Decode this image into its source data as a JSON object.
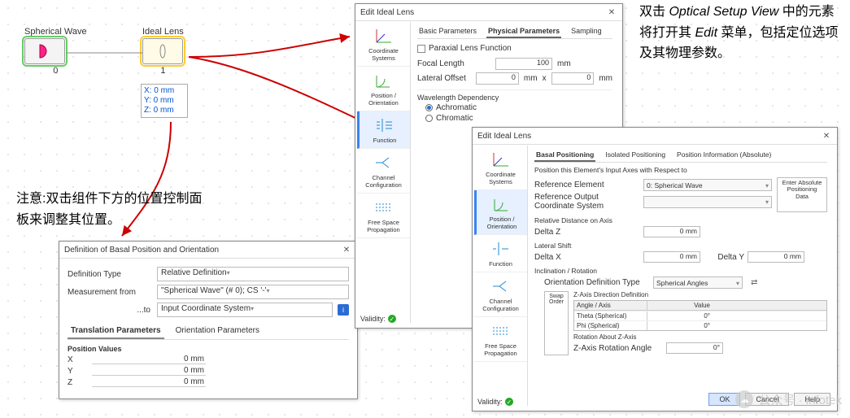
{
  "canvas": {
    "source": {
      "title": "Spherical Wave",
      "index": "0"
    },
    "lens": {
      "title": "Ideal Lens",
      "index": "1"
    },
    "pos_panel": {
      "x": "X: 0 mm",
      "y": "Y: 0 mm",
      "z": "Z: 0 mm"
    }
  },
  "anno_right_1": "双击 ",
  "anno_right_em1": "Optical Setup View",
  "anno_right_2": " 中的元素将打开其 ",
  "anno_right_em2": "Edit",
  "anno_right_3": " 菜单，包括定位选项及其物理参数。",
  "anno_left": "注意:双击组件下方的位置控制面板来调整其位置。",
  "d1": {
    "title": "Definition of Basal Position and Orientation",
    "deftype_label": "Definition Type",
    "deftype_value": "Relative Definition",
    "meas_label": "Measurement from",
    "meas_value": "\"Spherical Wave\" (# 0); CS '-'",
    "to_label": "...to",
    "to_value": "Input Coordinate System",
    "tab1": "Translation Parameters",
    "tab2": "Orientation Parameters",
    "posvals": "Position Values",
    "x": "X",
    "xv": "0 mm",
    "y": "Y",
    "yv": "0 mm",
    "z": "Z",
    "zv": "0 mm"
  },
  "sidebar_items": [
    {
      "label": "Coordinate Systems",
      "icon": "axes"
    },
    {
      "label": "Position / Orientation",
      "icon": "angle"
    },
    {
      "label": "Function",
      "icon": "wave"
    },
    {
      "label": "Channel Configuration",
      "icon": "split"
    },
    {
      "label": "Free Space Propagation",
      "icon": "dash"
    }
  ],
  "d2": {
    "title": "Edit Ideal Lens",
    "tabs": [
      "Basic Parameters",
      "Physical Parameters",
      "Sampling"
    ],
    "paraxial": "Paraxial Lens Function",
    "focal_label": "Focal Length",
    "focal_val": "100",
    "focal_unit": "mm",
    "lateral_label": "Lateral Offset",
    "lateral_x": "0",
    "lateral_unit1": "mm",
    "lateral_sep": "x",
    "lateral_y": "0",
    "lateral_unit2": "mm",
    "wdep": "Wavelength Dependency",
    "achromatic": "Achromatic",
    "chromatic": "Chromatic",
    "validity": "Validity:"
  },
  "d3": {
    "title": "Edit Ideal Lens",
    "tabs": [
      "Basal Positioning",
      "Isolated Positioning",
      "Position Information (Absolute)"
    ],
    "pos_text": "Position this Element's Input Axes with Respect to",
    "ref_el_label": "Reference Element",
    "ref_el_value": "0: Spherical Wave",
    "ref_cs_label": "Reference Output Coordinate System",
    "enter_btn": "Enter Absolute Positioning Data",
    "reldist": "Relative Distance on Axis",
    "dz_label": "Delta Z",
    "dz_val": "0 mm",
    "latshift": "Lateral Shift",
    "dx_label": "Delta X",
    "dx_val": "0 mm",
    "dy_label": "Delta Y",
    "dy_val": "0 mm",
    "incl": "Inclination / Rotation",
    "odef_label": "Orientation Definition Type",
    "odef_value": "Spherical Angles",
    "zdir": "Z-Axis Direction Definition",
    "th_col1": "Angle / Axis",
    "th_col2": "Value",
    "row1a": "Theta (Spherical)",
    "row1v": "0°",
    "row2a": "Phi (Spherical)",
    "row2v": "0°",
    "swap": "Swap Order",
    "rotz": "Rotation About Z-Axis",
    "zrot_label": "Z-Axis Rotation Angle",
    "zrot_val": "0°",
    "validity": "Validity:",
    "ok": "OK",
    "cancel": "Cancel",
    "help": "Help"
  },
  "watermark": "公众号 · infotek"
}
